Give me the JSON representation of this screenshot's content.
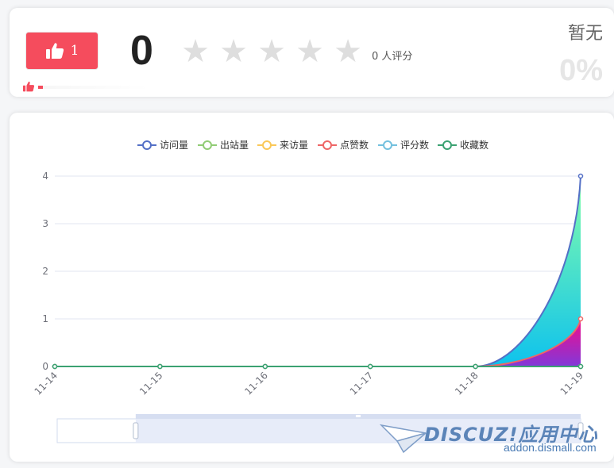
{
  "rating": {
    "like_count": "1",
    "score": "0",
    "stars": [
      "★",
      "★",
      "★",
      "★",
      "★"
    ],
    "rating_count_text": "0 人评分",
    "status_text": "暂无",
    "percent_text": "0%",
    "accent_color": "#f54c5d"
  },
  "chart_data": {
    "type": "line",
    "categories": [
      "11-14",
      "11-15",
      "11-16",
      "11-17",
      "11-18",
      "11-19"
    ],
    "ylim": [
      0,
      4
    ],
    "yticks": [
      0,
      1,
      2,
      3,
      4
    ],
    "grid": true,
    "legend_placement": "top-center",
    "smooth": true,
    "series": [
      {
        "name": "访问量",
        "values": [
          0,
          0,
          0,
          0,
          0,
          4
        ],
        "color": "#5470c6",
        "area": [
          "#80ffa5",
          "#01bfec"
        ]
      },
      {
        "name": "出站量",
        "values": [
          0,
          0,
          0,
          0,
          0,
          0
        ],
        "color": "#91cc75"
      },
      {
        "name": "来访量",
        "values": [
          0,
          0,
          0,
          0,
          0,
          0
        ],
        "color": "#fac858"
      },
      {
        "name": "点赞数",
        "values": [
          0,
          0,
          0,
          0,
          0,
          1
        ],
        "color": "#ee6666",
        "area": [
          "#ff0087",
          "#8731d8"
        ]
      },
      {
        "name": "评分数",
        "values": [
          0,
          0,
          0,
          0,
          0,
          0
        ],
        "color": "#73c0de"
      },
      {
        "name": "收藏数",
        "values": [
          0,
          0,
          0,
          0,
          0,
          0
        ],
        "color": "#3ba272"
      }
    ],
    "data_zoom": {
      "start": 0.15,
      "end": 1.0
    }
  },
  "watermark": {
    "brand": "DISCUZ!应用中心",
    "url": "addon.dismall.com"
  }
}
